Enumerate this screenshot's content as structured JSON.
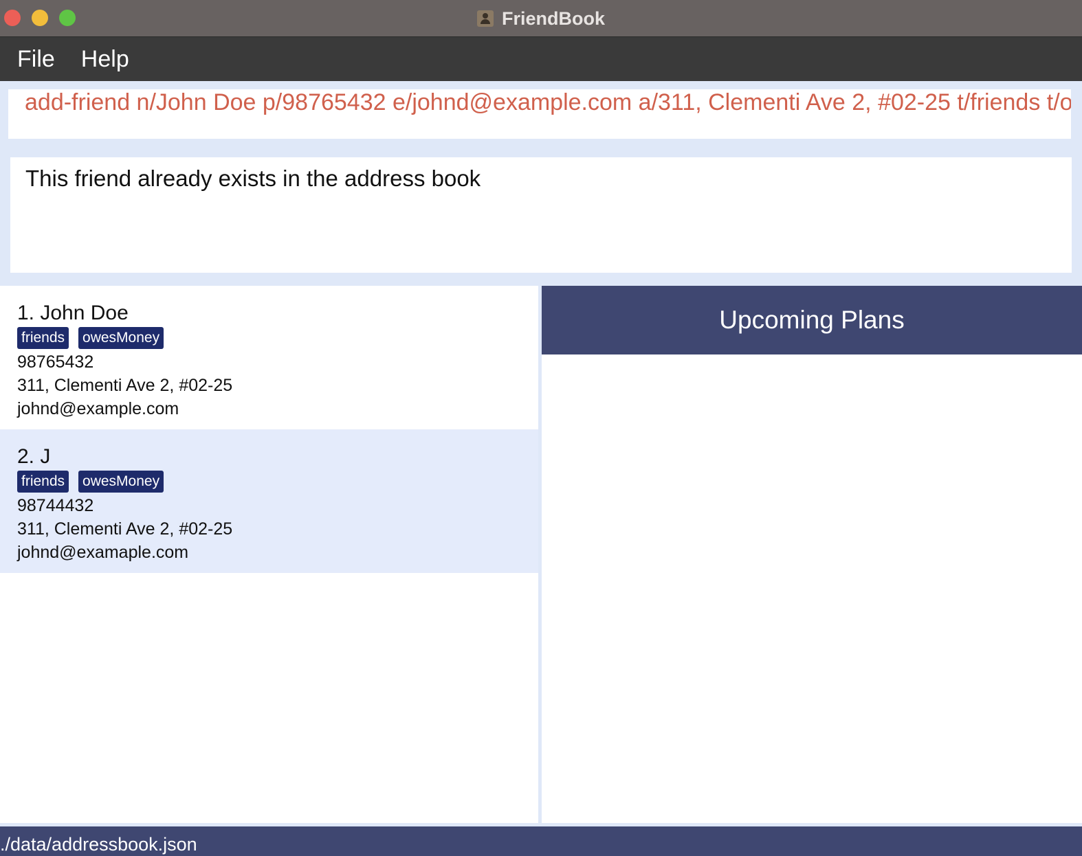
{
  "window": {
    "title": "FriendBook"
  },
  "menu": {
    "items": [
      "File",
      "Help"
    ]
  },
  "command": {
    "value": "add-friend n/John Doe p/98765432 e/johnd@example.com a/311, Clementi Ave 2, #02-25 t/friends t/ow"
  },
  "result": {
    "message": "This friend already exists in the address book"
  },
  "friends": [
    {
      "name": "1.  John Doe",
      "tags": [
        "friends",
        "owesMoney"
      ],
      "phone": "98765432",
      "address": "311, Clementi Ave 2, #02-25",
      "email": "johnd@example.com"
    },
    {
      "name": "2.  J",
      "tags": [
        "friends",
        "owesMoney"
      ],
      "phone": "98744432",
      "address": "311, Clementi Ave 2, #02-25",
      "email": "johnd@examaple.com"
    }
  ],
  "plans": {
    "header": "Upcoming Plans"
  },
  "status": {
    "path": "./data/addressbook.json"
  },
  "colors": {
    "command_text": "#d0604c",
    "tag_bg": "#1e2b6b",
    "header_bg": "#3f4771",
    "selected_card_bg": "#e4ebfb"
  }
}
